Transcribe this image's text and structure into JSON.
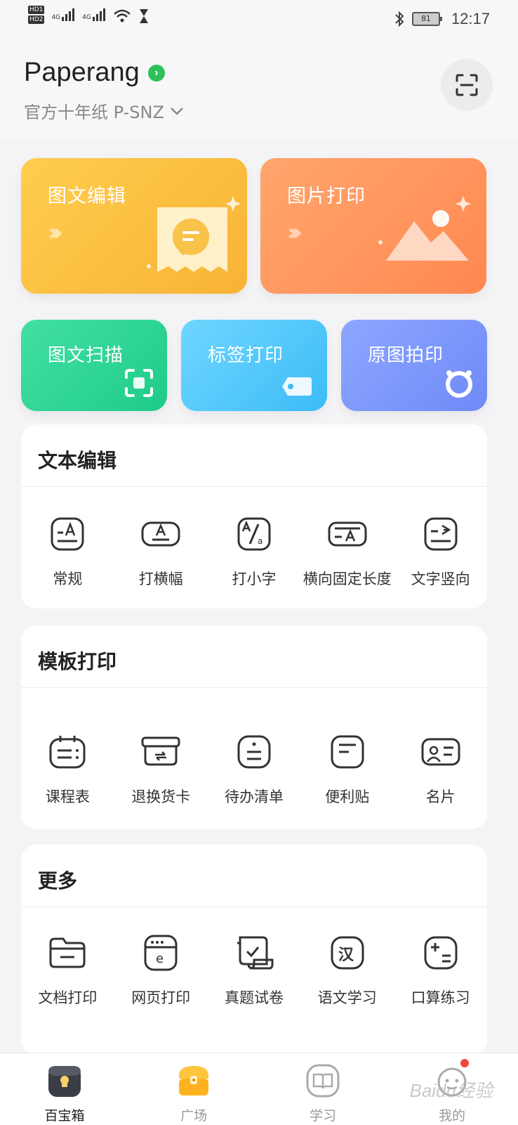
{
  "status_bar": {
    "hd1": "HD1",
    "hd2": "HD2",
    "net1": "4G",
    "net2": "4G",
    "battery": "81",
    "time": "12:17"
  },
  "header": {
    "app_name": "Paperang",
    "paper_type": "官方十年纸 P-SNZ"
  },
  "cards": {
    "image_text_edit": "图文编辑",
    "image_print": "图片打印",
    "image_text_scan": "图文扫描",
    "label_print": "标签打印",
    "original_print": "原图拍印"
  },
  "text_edit": {
    "title": "文本编辑",
    "items": [
      {
        "label": "常规",
        "icon": "text-regular-icon"
      },
      {
        "label": "打横幅",
        "icon": "banner-icon"
      },
      {
        "label": "打小字",
        "icon": "small-text-icon"
      },
      {
        "label": "横向固定长度",
        "icon": "fixed-length-icon"
      },
      {
        "label": "文字竖向",
        "icon": "vertical-text-icon"
      }
    ]
  },
  "template_print": {
    "title": "模板打印",
    "items": [
      {
        "label": "课程表",
        "icon": "schedule-icon"
      },
      {
        "label": "退换货卡",
        "icon": "return-card-icon"
      },
      {
        "label": "待办清单",
        "icon": "todo-list-icon"
      },
      {
        "label": "便利贴",
        "icon": "sticky-note-icon"
      },
      {
        "label": "名片",
        "icon": "business-card-icon"
      }
    ]
  },
  "more": {
    "title": "更多",
    "items": [
      {
        "label": "文档打印",
        "icon": "folder-icon"
      },
      {
        "label": "网页打印",
        "icon": "web-icon"
      },
      {
        "label": "真题试卷",
        "icon": "exam-scroll-icon"
      },
      {
        "label": "语文学习",
        "icon": "chinese-study-icon"
      },
      {
        "label": "口算练习",
        "icon": "math-practice-icon"
      }
    ]
  },
  "tabs": [
    {
      "label": "百宝箱",
      "icon": "toolbox-icon"
    },
    {
      "label": "广场",
      "icon": "treasure-chest-icon"
    },
    {
      "label": "学习",
      "icon": "study-book-icon"
    },
    {
      "label": "我的",
      "icon": "profile-icon"
    }
  ],
  "watermark": "Baidu经验",
  "colors": {
    "yellow_card": "#f8b334",
    "orange_card": "#ff8850",
    "green_card": "#1fcb88",
    "blue_card": "#3cbcf6",
    "purple_card": "#6f8af8",
    "brand_green": "#2ec05c",
    "notification_red": "#f2463c"
  }
}
